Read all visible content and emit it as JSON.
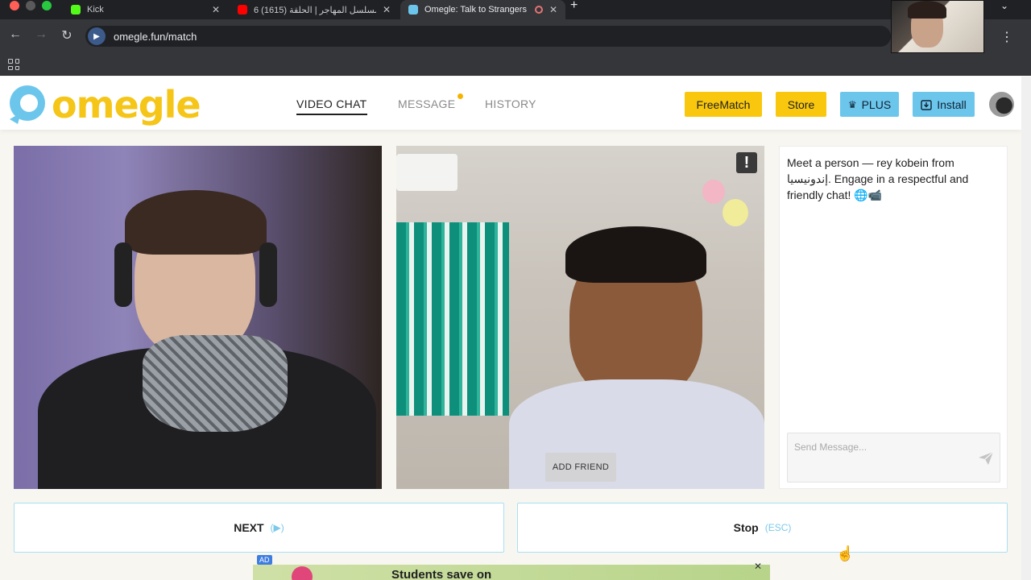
{
  "browser": {
    "tabs": [
      {
        "title": "Kick",
        "icon": "kick-icon",
        "color": "#53fc18"
      },
      {
        "title": "مسلسل المهاجر | الحلقة (1615) 6",
        "icon": "youtube-icon",
        "color": "#ff0000"
      },
      {
        "title": "Omegle: Talk to Strangers",
        "icon": "omegle-icon",
        "color": "#6cc6ec"
      }
    ],
    "url": "omegle.fun/match"
  },
  "site": {
    "logo_text": "omegle",
    "nav": [
      {
        "label": "VIDEO CHAT",
        "active": true
      },
      {
        "label": "MESSAGE",
        "active": false
      },
      {
        "label": "HISTORY",
        "active": false
      }
    ],
    "buttons": {
      "freematch": "FreeMatch",
      "store": "Store",
      "plus": "PLUS",
      "install": "Install"
    },
    "colors": {
      "brand_yellow": "#f9c80e",
      "accent_blue": "#6cc6ec"
    }
  },
  "video": {
    "add_friend": "ADD FRIEND",
    "report": "!"
  },
  "chat": {
    "message": "Meet a person — rey kobein from إندونيسيا. Engage in a respectful and friendly chat! 🌐📹",
    "placeholder": "Send Message..."
  },
  "actions": {
    "next_label": "NEXT",
    "next_hint": "(▶)",
    "stop_label": "Stop",
    "stop_hint": "(ESC)"
  },
  "ad": {
    "tag": "AD",
    "title": "Students save on",
    "close": "✕"
  }
}
